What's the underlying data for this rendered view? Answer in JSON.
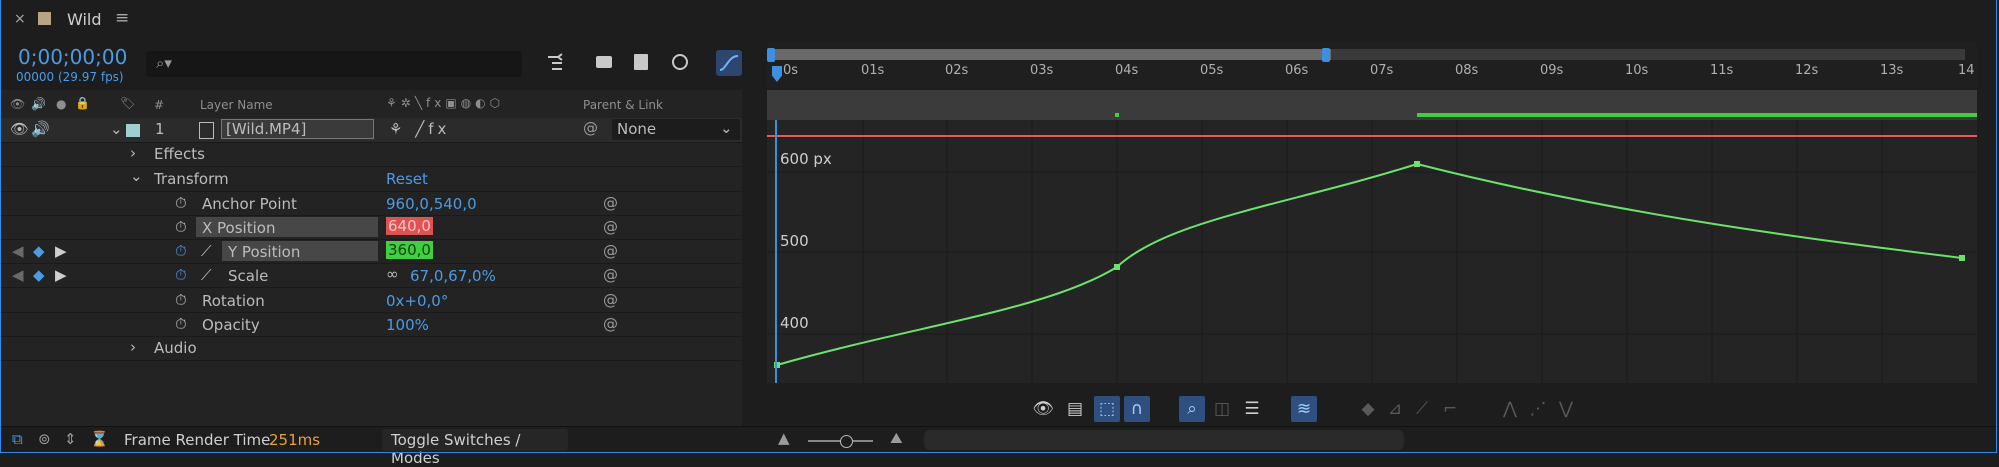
{
  "tab": {
    "close": "×",
    "title": "Wild",
    "menu": "≡",
    "swatch_color": "#b8a484"
  },
  "header": {
    "timecode": "0;00;00;00",
    "fps": "00000 (29.97 fps)",
    "search_icon": "⌕▾"
  },
  "columns": {
    "hash": "#",
    "layer_name": "Layer Name",
    "parent_link": "Parent & Link"
  },
  "layer": {
    "index": "1",
    "name": "[Wild.MP4]",
    "parent": "None"
  },
  "rows": {
    "effects": "Effects",
    "transform": "Transform",
    "reset": "Reset",
    "anchor_point": {
      "label": "Anchor Point",
      "value": "960,0,540,0"
    },
    "x_position": {
      "label": "X Position",
      "value": "640,0"
    },
    "y_position": {
      "label": "Y Position",
      "value": "360,0"
    },
    "scale": {
      "label": "Scale",
      "value": "67,0,67,0%"
    },
    "rotation": {
      "label": "Rotation",
      "value": "0x+0,0°"
    },
    "opacity": {
      "label": "Opacity",
      "value": "100%"
    },
    "audio": "Audio"
  },
  "ruler": {
    "ticks": [
      "0s",
      "01s",
      "02s",
      "03s",
      "04s",
      "05s",
      "06s",
      "07s",
      "08s",
      "09s",
      "10s",
      "11s",
      "12s",
      "13s",
      "14"
    ]
  },
  "graph": {
    "y_labels": [
      "600 px",
      "500",
      "400"
    ]
  },
  "footer": {
    "frame_render_label": "Frame Render Time",
    "frame_render_value": "251ms",
    "toggle_label": "Toggle Switches / Modes"
  },
  "colors": {
    "accent_blue": "#4b9be6",
    "x_position_bg": "#e05252",
    "y_position_bg": "#3fcf3f",
    "curve": "#6be36b",
    "red_line": "#e35b5b"
  }
}
